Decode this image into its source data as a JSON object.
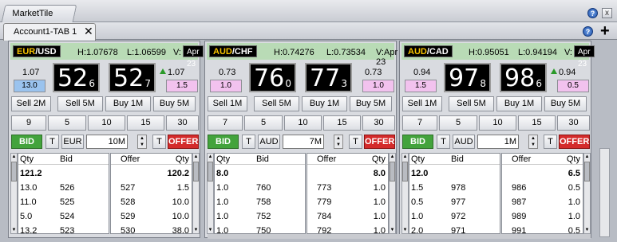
{
  "window": {
    "title": "MarketTile",
    "help": "?",
    "close": "x"
  },
  "tabs": {
    "active_label": "Account1-TAB 1",
    "close": "✕",
    "help": "?",
    "add": "+"
  },
  "tiles": [
    {
      "pair_base": "EUR",
      "pair_quote": "USD",
      "high": "H:1.07678",
      "low": "L:1.06599",
      "v_label": "V:",
      "value_date": "Apr 23",
      "left_top": "1.07",
      "left_box": "13.0",
      "right_top": "1.07",
      "right_box": "1.5",
      "bid_big": "52",
      "bid_small": "6",
      "offer_big": "52",
      "offer_small": "7",
      "row1": [
        "Sell 2M",
        "Sell 5M",
        "Buy 1M",
        "Buy 5M"
      ],
      "row2": [
        "9",
        "5",
        "10",
        "15",
        "30"
      ],
      "bid_label": "BID",
      "t1": "T",
      "ccy": "EUR",
      "qty": "10",
      "qty_unit": "M",
      "t2": "T",
      "offer_label": "OFFER",
      "bid_grid": {
        "qty_header": "Qty",
        "px_header": "Bid",
        "rows": [
          [
            "121.2",
            ""
          ],
          [
            "13.0",
            "526"
          ],
          [
            "11.0",
            "525"
          ],
          [
            "5.0",
            "524"
          ],
          [
            "13.2",
            "523"
          ]
        ]
      },
      "offer_grid": {
        "px_header": "Offer",
        "qty_header": "Qty",
        "rows": [
          [
            "",
            "120.2"
          ],
          [
            "527",
            "1.5"
          ],
          [
            "528",
            "10.0"
          ],
          [
            "529",
            "10.0"
          ],
          [
            "530",
            "38.0"
          ]
        ]
      }
    },
    {
      "pair_base": "AUD",
      "pair_quote": "CHF",
      "high": "H:0.74276",
      "low": "L:0.73534",
      "v_label": "V:Apr 23",
      "value_date": "",
      "left_top": "0.73",
      "left_box": "1.0",
      "right_top": "0.73",
      "right_box": "1.0",
      "bid_big": "76",
      "bid_small": "0",
      "offer_big": "77",
      "offer_small": "3",
      "row1": [
        "Sell 1M",
        "Sell 5M",
        "Buy 1M",
        "Buy 5M"
      ],
      "row2": [
        "7",
        "5",
        "10",
        "15",
        "30"
      ],
      "bid_label": "BID",
      "t1": "T",
      "ccy": "AUD",
      "qty": "7",
      "qty_unit": "M",
      "t2": "T",
      "offer_label": "OFFER",
      "bid_grid": {
        "qty_header": "Qty",
        "px_header": "Bid",
        "rows": [
          [
            "8.0",
            ""
          ],
          [
            "1.0",
            "760"
          ],
          [
            "1.0",
            "758"
          ],
          [
            "1.0",
            "752"
          ],
          [
            "1.0",
            "750"
          ]
        ]
      },
      "offer_grid": {
        "px_header": "Offer",
        "qty_header": "Qty",
        "rows": [
          [
            "",
            "8.0"
          ],
          [
            "773",
            "1.0"
          ],
          [
            "779",
            "1.0"
          ],
          [
            "784",
            "1.0"
          ],
          [
            "792",
            "1.0"
          ]
        ]
      }
    },
    {
      "pair_base": "AUD",
      "pair_quote": "CAD",
      "high": "H:0.95051",
      "low": "L:0.94194",
      "v_label": "V:",
      "value_date": "Apr 23",
      "left_top": "0.94",
      "left_box": "1.5",
      "right_top": "0.94",
      "right_box": "0.5",
      "bid_big": "97",
      "bid_small": "8",
      "offer_big": "98",
      "offer_small": "6",
      "row1": [
        "Sell 1M",
        "Sell 5M",
        "Buy 1M",
        "Buy 5M"
      ],
      "row2": [
        "7",
        "5",
        "10",
        "15",
        "30"
      ],
      "bid_label": "BID",
      "t1": "T",
      "ccy": "AUD",
      "qty": "1",
      "qty_unit": "M",
      "t2": "T",
      "offer_label": "OFFER",
      "bid_grid": {
        "qty_header": "Qty",
        "px_header": "Bid",
        "rows": [
          [
            "12.0",
            ""
          ],
          [
            "1.5",
            "978"
          ],
          [
            "0.5",
            "977"
          ],
          [
            "1.0",
            "972"
          ],
          [
            "2.0",
            "971"
          ]
        ]
      },
      "offer_grid": {
        "px_header": "Offer",
        "qty_header": "Qty",
        "rows": [
          [
            "",
            "6.5"
          ],
          [
            "986",
            "0.5"
          ],
          [
            "987",
            "1.0"
          ],
          [
            "989",
            "1.0"
          ],
          [
            "991",
            "0.5"
          ]
        ]
      }
    }
  ]
}
